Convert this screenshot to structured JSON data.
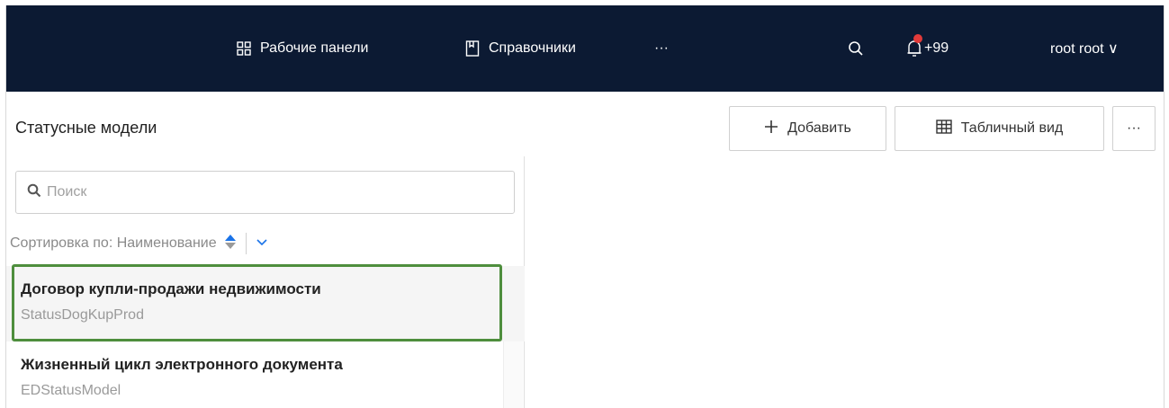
{
  "header": {
    "nav": [
      {
        "label": "Рабочие панели",
        "icon": "grid-icon"
      },
      {
        "label": "Справочники",
        "icon": "book-icon"
      },
      {
        "label": "···",
        "icon": "more-icon"
      }
    ],
    "notifications_count": "+99",
    "user": "root root ∨"
  },
  "page": {
    "title": "Статусные модели",
    "add_label": "Добавить",
    "table_view_label": "Табличный вид",
    "more_label": "···"
  },
  "search": {
    "placeholder": "Поиск"
  },
  "sort": {
    "label": "Сортировка по: Наименование"
  },
  "list": [
    {
      "title": "Договор купли-продажи недвижимости",
      "code": "StatusDogKupProd",
      "selected": true
    },
    {
      "title": "Жизненный цикл электронного документа",
      "code": "EDStatusModel",
      "selected": false
    }
  ],
  "colors": {
    "header_bg": "#0c1a33",
    "selected_outline": "#4e8e3d",
    "accent": "#1a73e8",
    "notification_dot": "#e23a3a"
  }
}
